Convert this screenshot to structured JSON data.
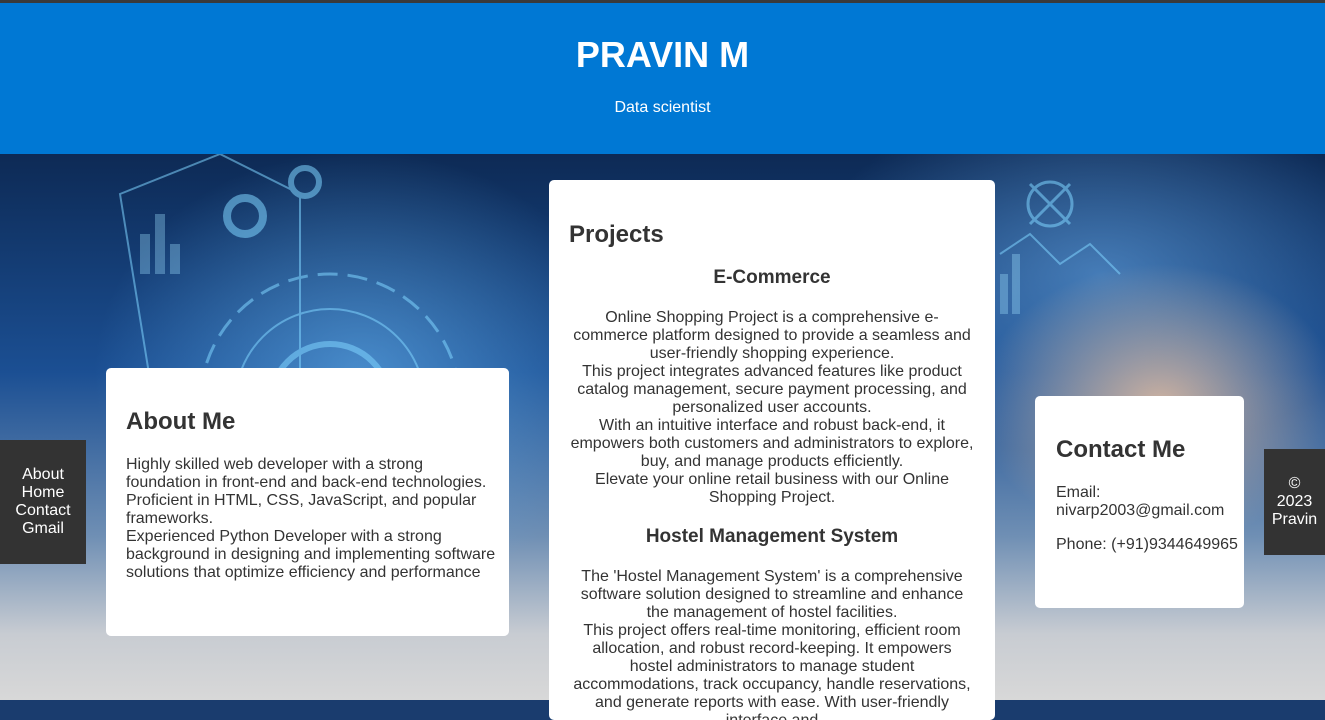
{
  "header": {
    "name": "PRAVIN M",
    "role": "Data scientist"
  },
  "about": {
    "title": "About Me",
    "lines": [
      "Highly skilled web developer with a strong foundation in front-end and back-end technologies. Proficient in HTML, CSS, JavaScript, and popular frameworks.",
      "Experienced Python Developer with a strong background in designing and implementing software solutions that optimize efficiency and performance"
    ]
  },
  "projects": {
    "title": "Projects",
    "items": [
      {
        "name": "E-Commerce",
        "lines": [
          "Online Shopping Project is a comprehensive e-commerce platform designed to provide a seamless and user-friendly shopping experience.",
          "This project integrates advanced features like product catalog management, secure payment processing, and personalized user accounts.",
          "With an intuitive interface and robust back-end, it empowers both customers and administrators to explore, buy, and manage products efficiently.",
          "Elevate your online retail business with our Online Shopping Project."
        ]
      },
      {
        "name": "Hostel Management System",
        "lines": [
          "The 'Hostel Management System' is a comprehensive software solution designed to streamline and enhance the management of hostel facilities.",
          "This project offers real-time monitoring, efficient room allocation, and robust record-keeping. It empowers hostel administrators to manage student accommodations, track occupancy, handle reservations, and generate reports with ease. With user-friendly interface and"
        ]
      }
    ]
  },
  "contact": {
    "title": "Contact Me",
    "email": "Email: nivarp2003@gmail.com",
    "phone": "Phone: (+91)9344649965"
  },
  "sidenav": {
    "about": "About",
    "home": "Home",
    "contact": "Contact",
    "gmail": "Gmail"
  },
  "footer": {
    "copyright": "©",
    "year": "2023",
    "name": "Pravin"
  },
  "colors": {
    "header_bg": "#0078d4",
    "panel_bg": "#333333",
    "card_bg": "#ffffff"
  },
  "background_image": "laptop with futuristic holographic data interface"
}
